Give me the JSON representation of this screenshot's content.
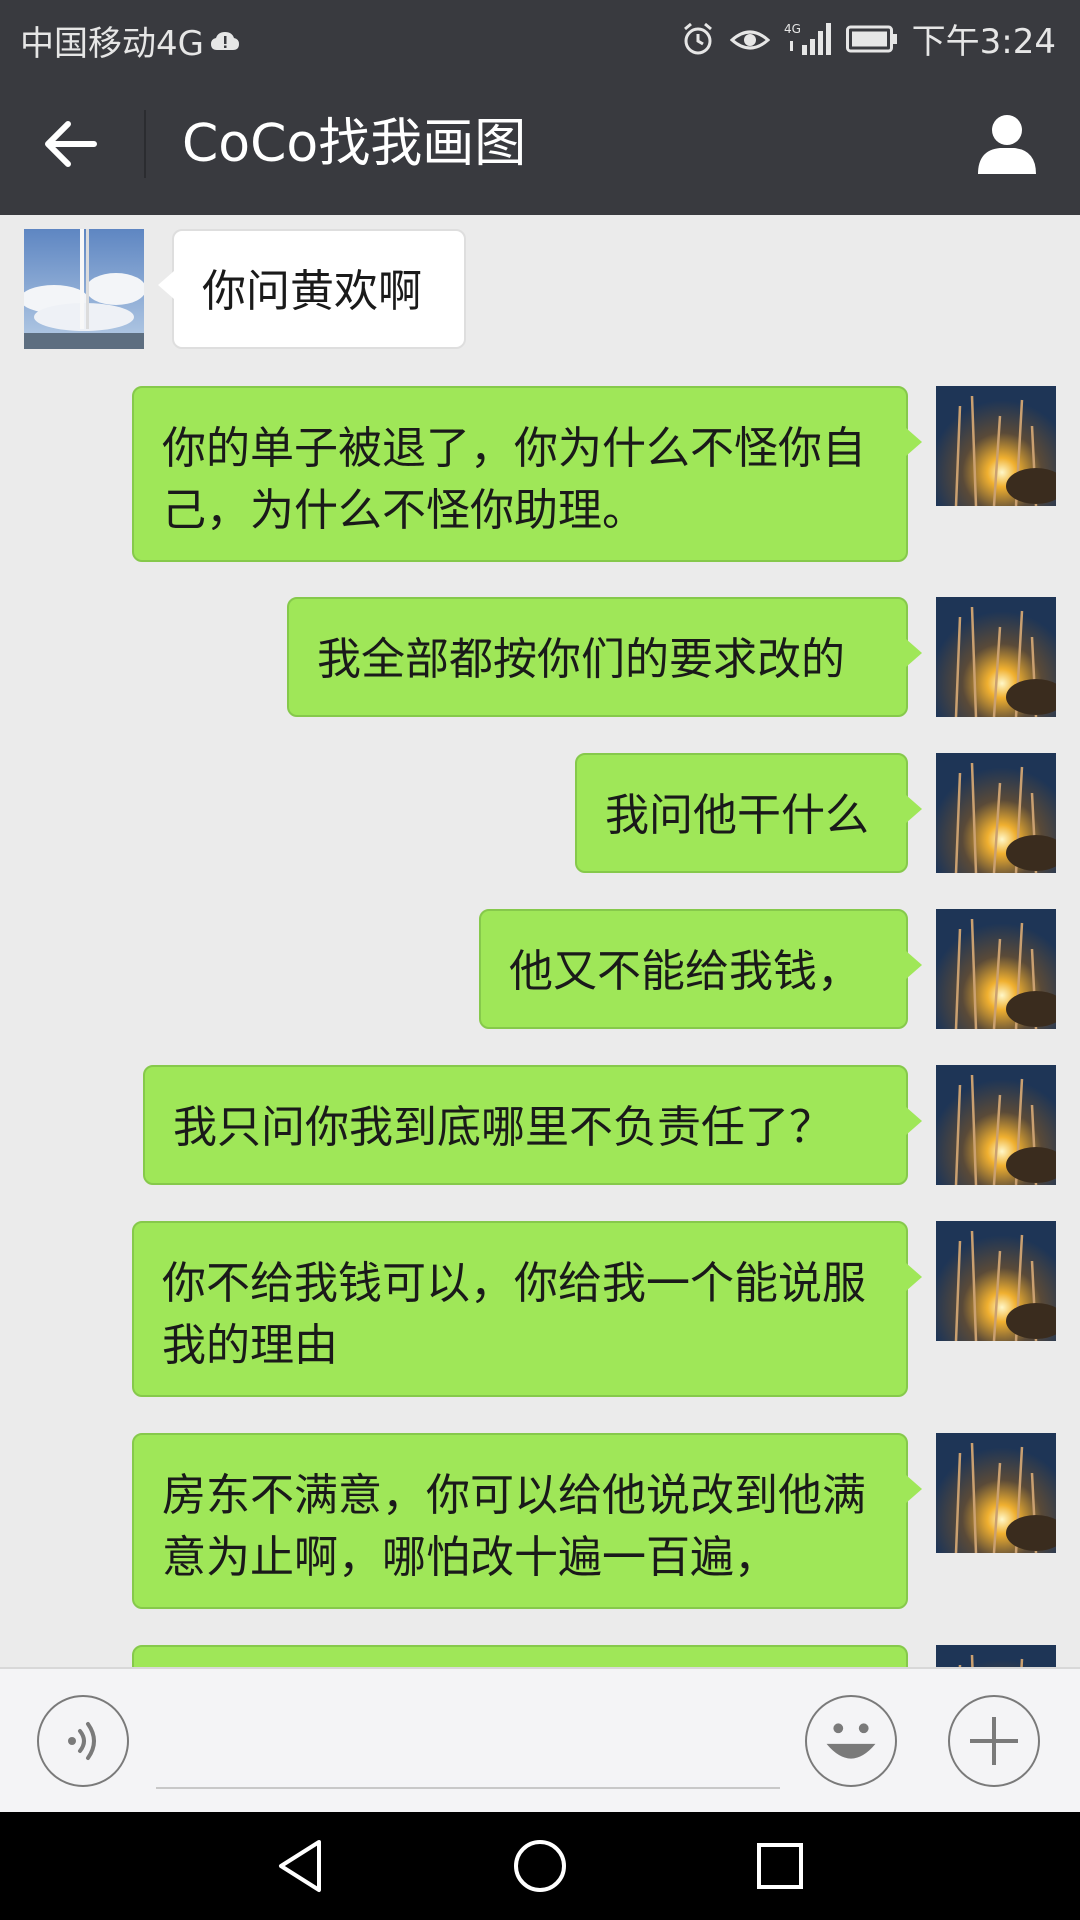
{
  "status_bar": {
    "carrier": "中国移动4G",
    "time": "下午3:24",
    "icons": [
      "cloud-alert-icon",
      "alarm-icon",
      "eye-icon",
      "signal-4g-icon",
      "battery-icon"
    ]
  },
  "header": {
    "title": "CoCo找我画图",
    "back_icon": "arrow-left-icon",
    "profile_icon": "person-icon"
  },
  "messages": [
    {
      "sender": "them",
      "text": "你问黄欢啊"
    },
    {
      "sender": "me",
      "text": "你的单子被退了，你为什么不怪你自己，为什么不怪你助理。"
    },
    {
      "sender": "me",
      "text": "我全部都按你们的要求改的"
    },
    {
      "sender": "me",
      "text": "我问他干什么"
    },
    {
      "sender": "me",
      "text": "他又不能给我钱，"
    },
    {
      "sender": "me",
      "text": "我只问你我到底哪里不负责任了？"
    },
    {
      "sender": "me",
      "text": "你不给我钱可以，你给我一个能说服我的理由"
    },
    {
      "sender": "me",
      "text": "房东不满意，你可以给他说改到他满意为止啊，哪怕改十遍一百遍，"
    }
  ],
  "input_bar": {
    "voice_icon": "voice-icon",
    "emoji_icon": "emoji-icon",
    "plus_icon": "plus-icon"
  },
  "system_nav": {
    "icons": [
      "back-triangle-icon",
      "home-circle-icon",
      "recents-square-icon"
    ]
  },
  "colors": {
    "header_bg": "#393a3f",
    "chat_bg": "#ebebeb",
    "my_bubble": "#9fe758",
    "their_bubble": "#ffffff"
  }
}
